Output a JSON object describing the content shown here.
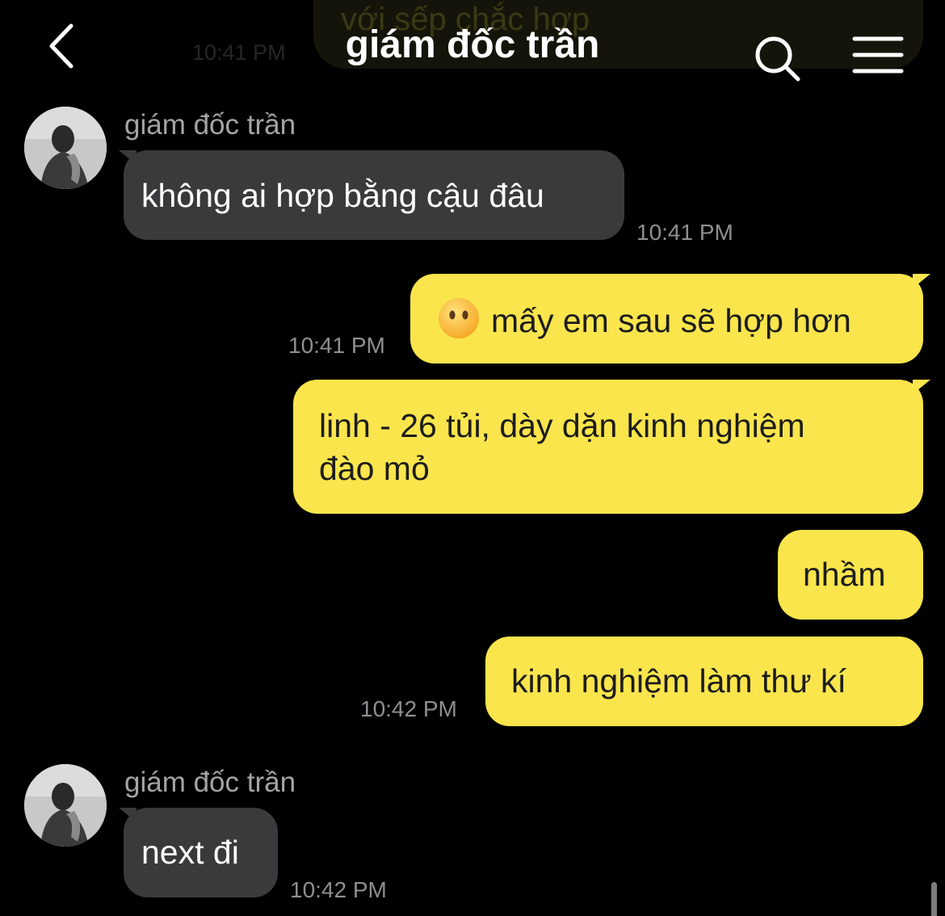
{
  "header": {
    "title": "giám đốc trần",
    "prev_bubble_text": "với sếp chắc hợp",
    "prev_time": "10:41 PM"
  },
  "icons": {
    "back": "chevron-left-icon",
    "search": "search-icon",
    "menu": "hamburger-menu-icon",
    "emoji": "face-without-mouth-emoji"
  },
  "colors": {
    "background": "#000000",
    "incoming_bubble": "#3a3a3c",
    "outgoing_bubble": "#fae54c",
    "timestamp": "#8e8e93",
    "sender_name": "#a4a4a4"
  },
  "messages": [
    {
      "direction": "in",
      "sender": "giám đốc trần",
      "text": "không ai hợp bằng cậu đâu",
      "time": "10:41 PM"
    },
    {
      "direction": "out",
      "emoji": "😶",
      "text": "mấy em sau sẽ hợp hơn",
      "time": "10:41 PM"
    },
    {
      "direction": "out",
      "line1": "linh - 26 tủi, dày dặn kinh nghiệm",
      "line2": "đào mỏ"
    },
    {
      "direction": "out",
      "text": "nhầm"
    },
    {
      "direction": "out",
      "text": "kinh nghiệm làm thư kí",
      "time": "10:42 PM"
    },
    {
      "direction": "in",
      "sender": "giám đốc trần",
      "text": "next đi",
      "time": "10:42 PM"
    }
  ]
}
